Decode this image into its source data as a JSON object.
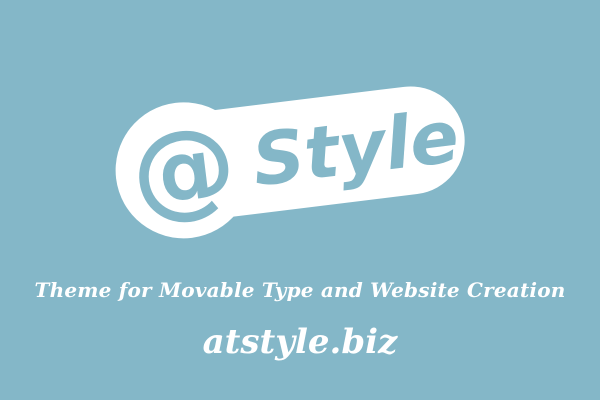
{
  "background_color": "#84b7c8",
  "logo": {
    "text": "@ Style",
    "fill_color": "#84b7c8",
    "badge_color": "#ffffff"
  },
  "tagline": "Theme for Movable Type and Website Creation",
  "site_url": "atstyle.biz"
}
